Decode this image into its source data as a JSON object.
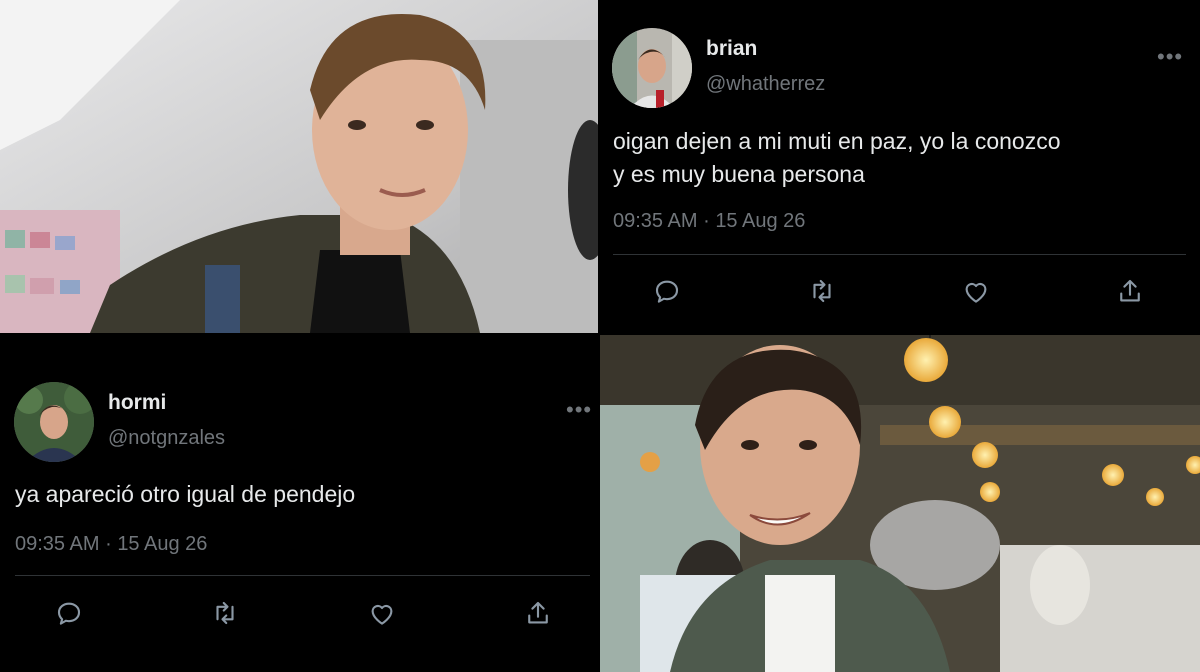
{
  "tweets": [
    {
      "name": "brian",
      "handle": "@whatherrez",
      "text_lines": [
        "oigan dejen a mi muti en paz, yo la conozco",
        "y es muy buena persona"
      ],
      "time": "09:35 AM",
      "date": "15 Aug 26",
      "separator": "·",
      "more": "•••"
    },
    {
      "name": "hormi",
      "handle": "@notgnzales",
      "text_lines": [
        "ya apareció otro igual de pendejo"
      ],
      "time": "09:35 AM",
      "date": "15 Aug 26",
      "separator": "·",
      "more": "•••"
    }
  ],
  "icons": [
    "reply-icon",
    "retweet-icon",
    "like-icon",
    "share-icon"
  ],
  "colors": {
    "background": "#000000",
    "text": "#e7e9ea",
    "muted": "#71767b",
    "divider": "#2f3336"
  }
}
